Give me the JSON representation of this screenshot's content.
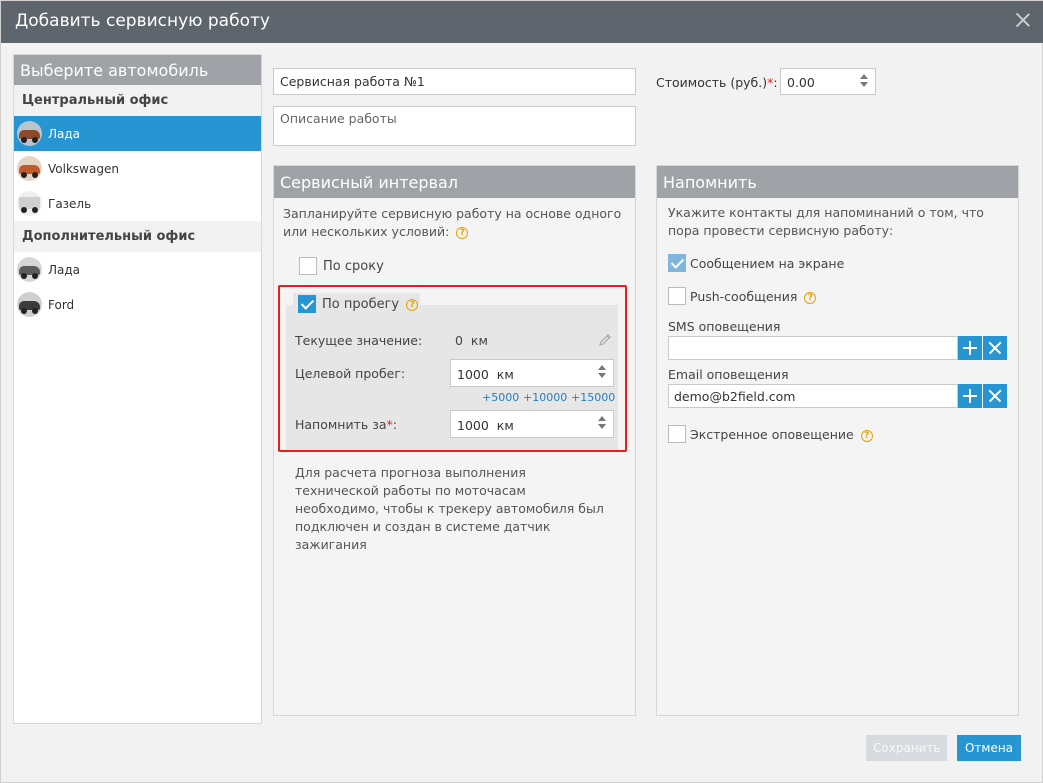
{
  "dialog": {
    "title": "Добавить сервисную работу"
  },
  "vehicles": {
    "header": "Выберите автомобиль",
    "groups": [
      {
        "name": "Центральный офис",
        "items": [
          {
            "label": "Лада",
            "selected": true,
            "color": "#8a4b2c"
          },
          {
            "label": "Volkswagen",
            "selected": false,
            "color": "#c25a2a"
          },
          {
            "label": "Газель",
            "selected": false,
            "color": "#d8d8d8"
          }
        ]
      },
      {
        "name": "Дополнительный офис",
        "items": [
          {
            "label": "Лада",
            "selected": false,
            "color": "#5c5c5c"
          },
          {
            "label": "Ford",
            "selected": false,
            "color": "#3b3b3b"
          }
        ]
      }
    ]
  },
  "work": {
    "name_value": "Сервисная работа №1",
    "description_placeholder": "Описание работы",
    "cost_label": "Стоимость (руб.)",
    "cost_required_mark": "*",
    "cost_suffix": ":",
    "cost_value": "0.00"
  },
  "interval": {
    "header": "Сервисный интервал",
    "intro": "Запланируйте сервисную работу на основе одного или нескольких условий:",
    "by_term_label": "По сроку",
    "by_term_checked": false,
    "by_mileage_label": "По пробегу",
    "by_mileage_checked": true,
    "current_label": "Текущее значение:",
    "current_value": "0",
    "current_unit": "км",
    "target_label": "Целевой пробег:",
    "target_value": "1000",
    "target_unit": "км",
    "quick_adds": [
      "+5000",
      "+10000",
      "+15000"
    ],
    "remind_label": "Напомнить за",
    "remind_required_mark": "*",
    "remind_suffix": ":",
    "remind_value": "1000",
    "remind_unit": "км",
    "note": "Для расчета прогноза выполнения технической работы по моточасам необходимо, чтобы к трекеру автомобиля был подключен и создан в системе датчик зажигания"
  },
  "remind": {
    "header": "Напомнить",
    "intro": "Укажите контакты для напоминаний о том, что пора провести сервисную работу:",
    "screen_message_label": "Сообщением на экране",
    "screen_message_checked": true,
    "push_label": "Push-сообщения",
    "push_checked": false,
    "sms_label": "SMS оповещения",
    "sms_value": "",
    "email_label": "Email оповещения",
    "email_value": "demo@b2field.com",
    "emergency_label": "Экстренное оповещение",
    "emergency_checked": false
  },
  "footer": {
    "save_label": "Сохранить",
    "cancel_label": "Отмена"
  },
  "colors": {
    "accent": "#2795d2",
    "header_gray": "#9fa3a8",
    "title_bar": "#5f656d",
    "highlight_frame": "#e81d1d",
    "help": "#e6a200"
  }
}
